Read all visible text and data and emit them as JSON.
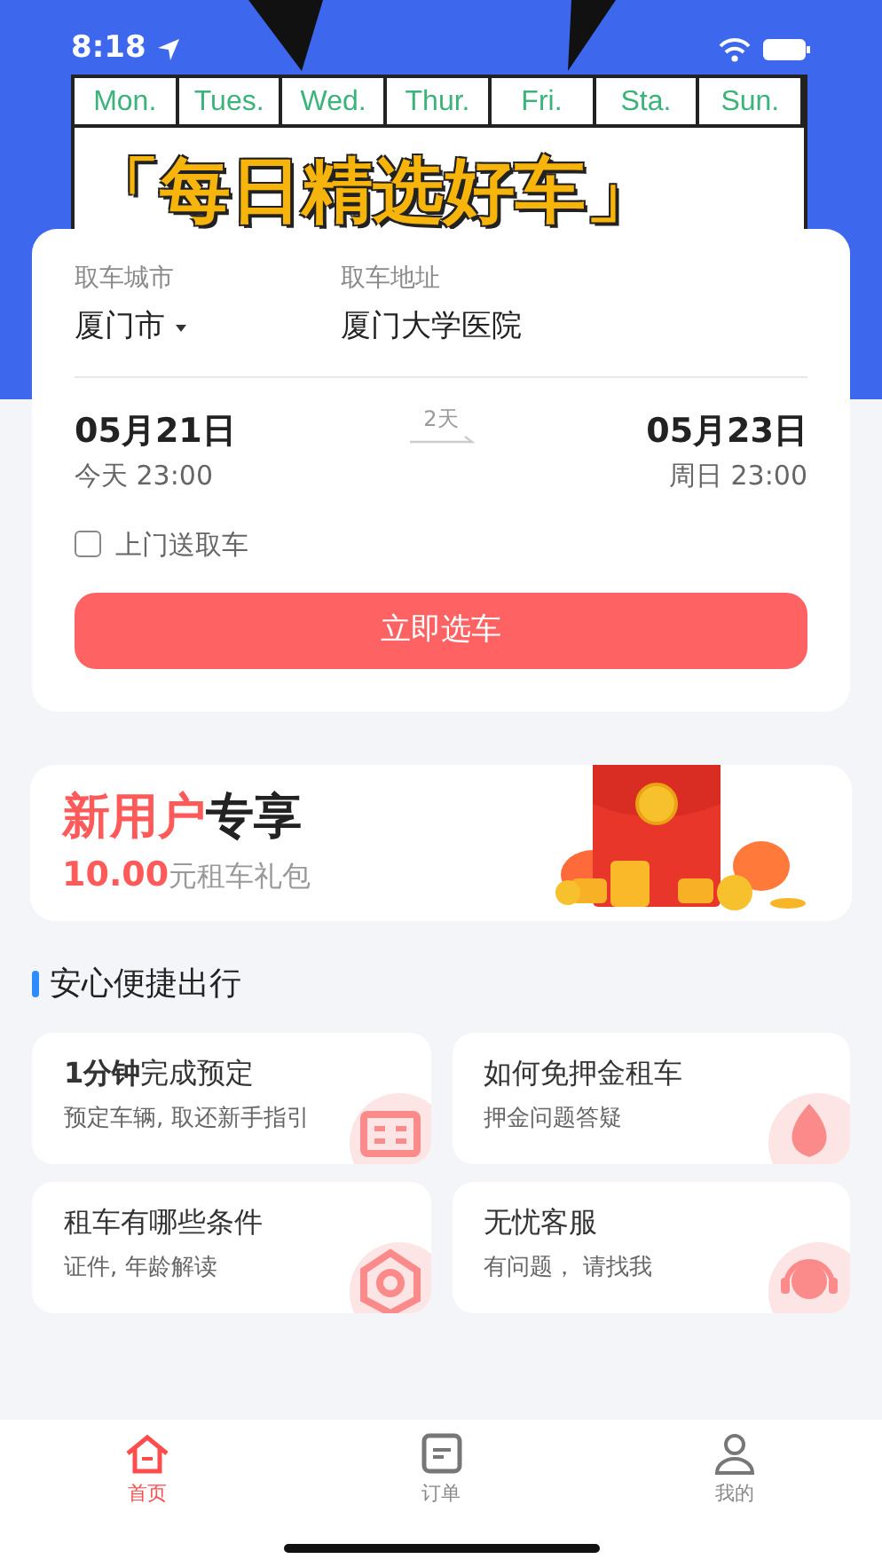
{
  "status_bar": {
    "time": "8:18"
  },
  "banner": {
    "days": [
      "Mon.",
      "Tues.",
      "Wed.",
      "Thur.",
      "Fri.",
      "Sta.",
      "Sun."
    ],
    "title": "「每日精选好车」"
  },
  "booking": {
    "city_label": "取车城市",
    "city": "厦门市",
    "address_label": "取车地址",
    "address": "厦门大学医院",
    "pickup": {
      "date": "05月21日",
      "time": "今天 23:00"
    },
    "duration": "2天",
    "return": {
      "date": "05月23日",
      "time": "周日 23:00"
    },
    "door_delivery": {
      "label": "上门送取车",
      "checked": false
    },
    "button": "立即选车"
  },
  "promo": {
    "title_highlight": "新用户",
    "title_rest": "专享",
    "amount": "10.00",
    "amount_suffix": "元租车礼包"
  },
  "section_title": "安心便捷出行",
  "features": [
    {
      "title": "**1分钟**完成预定",
      "subtitle": "预定车辆, 取还新手指引",
      "kind": "book"
    },
    {
      "title": "如何免押金租车",
      "subtitle": "押金问题答疑",
      "kind": "drop"
    },
    {
      "title": "租车有哪些条件",
      "subtitle": "证件, 年龄解读",
      "kind": "eye"
    },
    {
      "title": "无忧客服",
      "subtitle": "有问题， 请找我",
      "kind": "headset"
    }
  ],
  "tabs": [
    {
      "label": "首页",
      "selected": true,
      "kind": "home"
    },
    {
      "label": "订单",
      "selected": false,
      "kind": "order"
    },
    {
      "label": "我的",
      "selected": false,
      "kind": "user"
    }
  ]
}
